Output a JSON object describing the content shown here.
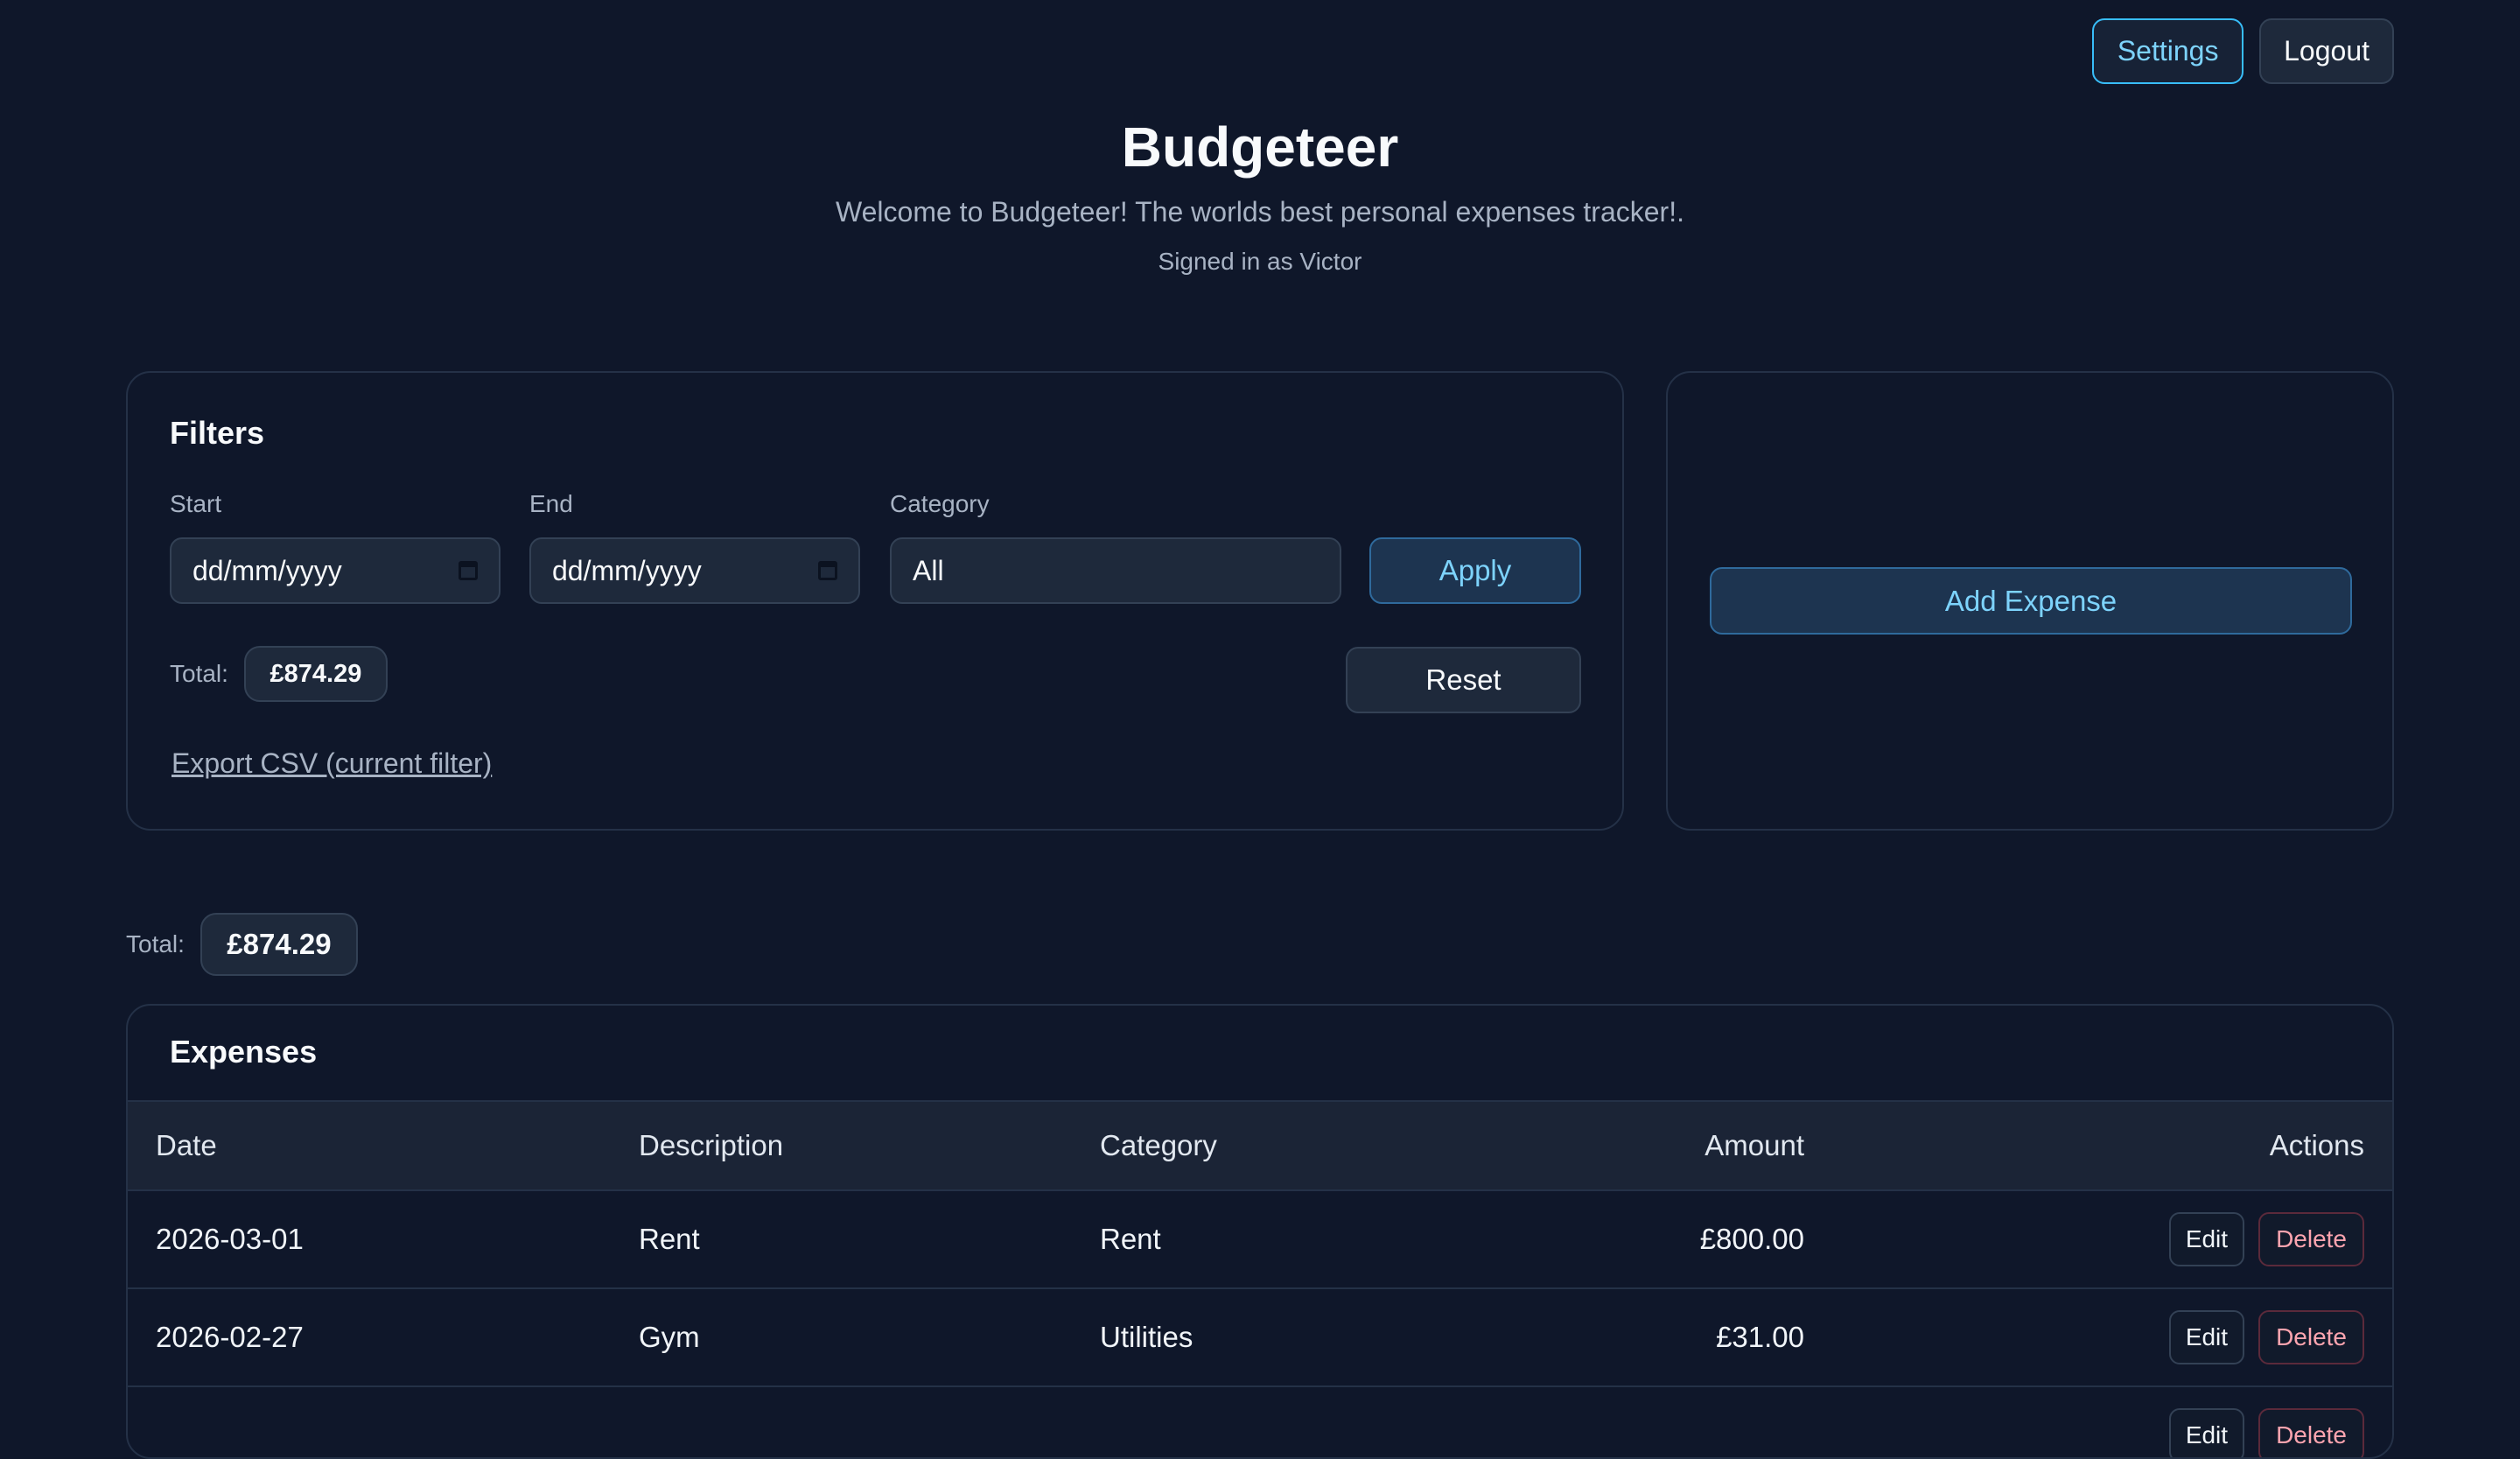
{
  "header": {
    "settings_label": "Settings",
    "logout_label": "Logout",
    "title": "Budgeteer",
    "subtitle": "Welcome to Budgeteer! The worlds best personal expenses tracker!.",
    "signed_in": "Signed in as Victor"
  },
  "filters": {
    "title": "Filters",
    "start_label": "Start",
    "start_value": "dd/mm/yyyy",
    "end_label": "End",
    "end_value": "dd/mm/yyyy",
    "category_label": "Category",
    "category_value": "All",
    "apply_label": "Apply",
    "reset_label": "Reset",
    "total_label": "Total:",
    "total_value": "£874.29",
    "export_label": "Export CSV (current filter)"
  },
  "add_panel": {
    "add_label": "Add Expense"
  },
  "summary": {
    "total_label": "Total:",
    "total_value": "£874.29"
  },
  "expenses": {
    "title": "Expenses",
    "columns": [
      "Date",
      "Description",
      "Category",
      "Amount",
      "Actions"
    ],
    "rows": [
      {
        "date": "2026-03-01",
        "description": "Rent",
        "category": "Rent",
        "amount": "£800.00",
        "edit": "Edit",
        "delete": "Delete"
      },
      {
        "date": "2026-02-27",
        "description": "Gym",
        "category": "Utilities",
        "amount": "£31.00",
        "edit": "Edit",
        "delete": "Delete"
      },
      {
        "date": "",
        "description": "",
        "category": "",
        "amount": "",
        "edit": "Edit",
        "delete": "Delete"
      }
    ]
  },
  "colors": {
    "background": "#0f172a",
    "accent": "#38bdf8",
    "danger": "#fda4af"
  }
}
